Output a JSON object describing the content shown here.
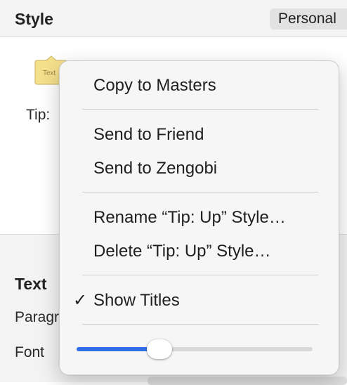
{
  "header": {
    "title": "Style",
    "personal_label": "Personal"
  },
  "style_list": {
    "thumbnail_text": "Text",
    "tip_label": "Tip:"
  },
  "text_section": {
    "title": "Text",
    "paragraph_label": "Paragr",
    "font_label": "Font"
  },
  "menu": {
    "copy_to_masters": "Copy to Masters",
    "send_to_friend": "Send to Friend",
    "send_to_zengobi": "Send to Zengobi",
    "rename_style": "Rename “Tip: Up” Style…",
    "delete_style": "Delete “Tip: Up” Style…",
    "show_titles": "Show Titles",
    "show_titles_checked": true,
    "check_mark": "✓",
    "size_slider_value": 0.35
  },
  "colors": {
    "accent": "#2f6fe6",
    "menu_bg": "#f6f6f6",
    "panel_bg": "#f3f3f3"
  }
}
